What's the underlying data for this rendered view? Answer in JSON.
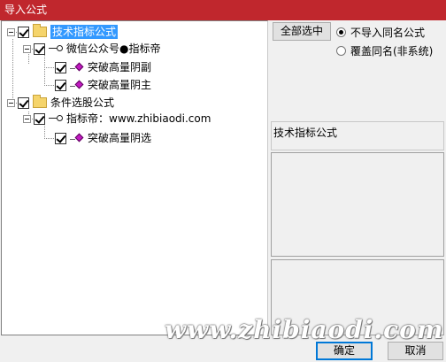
{
  "window": {
    "title": "导入公式"
  },
  "tree": {
    "group1": {
      "label": "技术指标公式",
      "author": "微信公众号●指标帝",
      "items": [
        "突破高量阴副",
        "突破高量阴主"
      ]
    },
    "group2": {
      "label": "条件选股公式",
      "author": "指标帝：www.zhibiaodi.com",
      "items": [
        "突破高量阴选"
      ]
    }
  },
  "options": {
    "select_all_label": "全部选中",
    "radio_skip_label": "不导入同名公式",
    "radio_overwrite_label": "覆盖同名(非系统)",
    "selected": "skip"
  },
  "info": {
    "type_label": "技术指标公式"
  },
  "footer": {
    "ok_label": "确定",
    "cancel_label": "取消"
  },
  "watermark": "www.zhibiaodi.com",
  "colors": {
    "titlebar": "#c0272d",
    "selection": "#3399ff",
    "diamond": "#c219c2"
  }
}
